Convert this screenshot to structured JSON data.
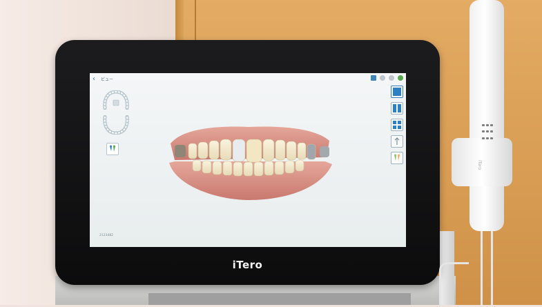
{
  "device": {
    "brand": "iTero"
  },
  "app": {
    "title": "ビュー",
    "scan_id": "2123482"
  },
  "toolbar": {
    "icons": [
      "camera-icon",
      "gear-icon",
      "settings-icon",
      "help-icon"
    ]
  },
  "left_panel": {
    "icons": [
      "upper-arch-icon",
      "lower-arch-icon",
      "tooth-view-icon"
    ]
  },
  "right_panel": {
    "tools": [
      "single-view-icon",
      "split-view-icon",
      "quad-view-icon",
      "tool-4-icon",
      "tool-5-icon"
    ]
  },
  "colors": {
    "accent": "#2f80c2",
    "screen_bg": "#eef2f3",
    "bezel": "#151516"
  }
}
